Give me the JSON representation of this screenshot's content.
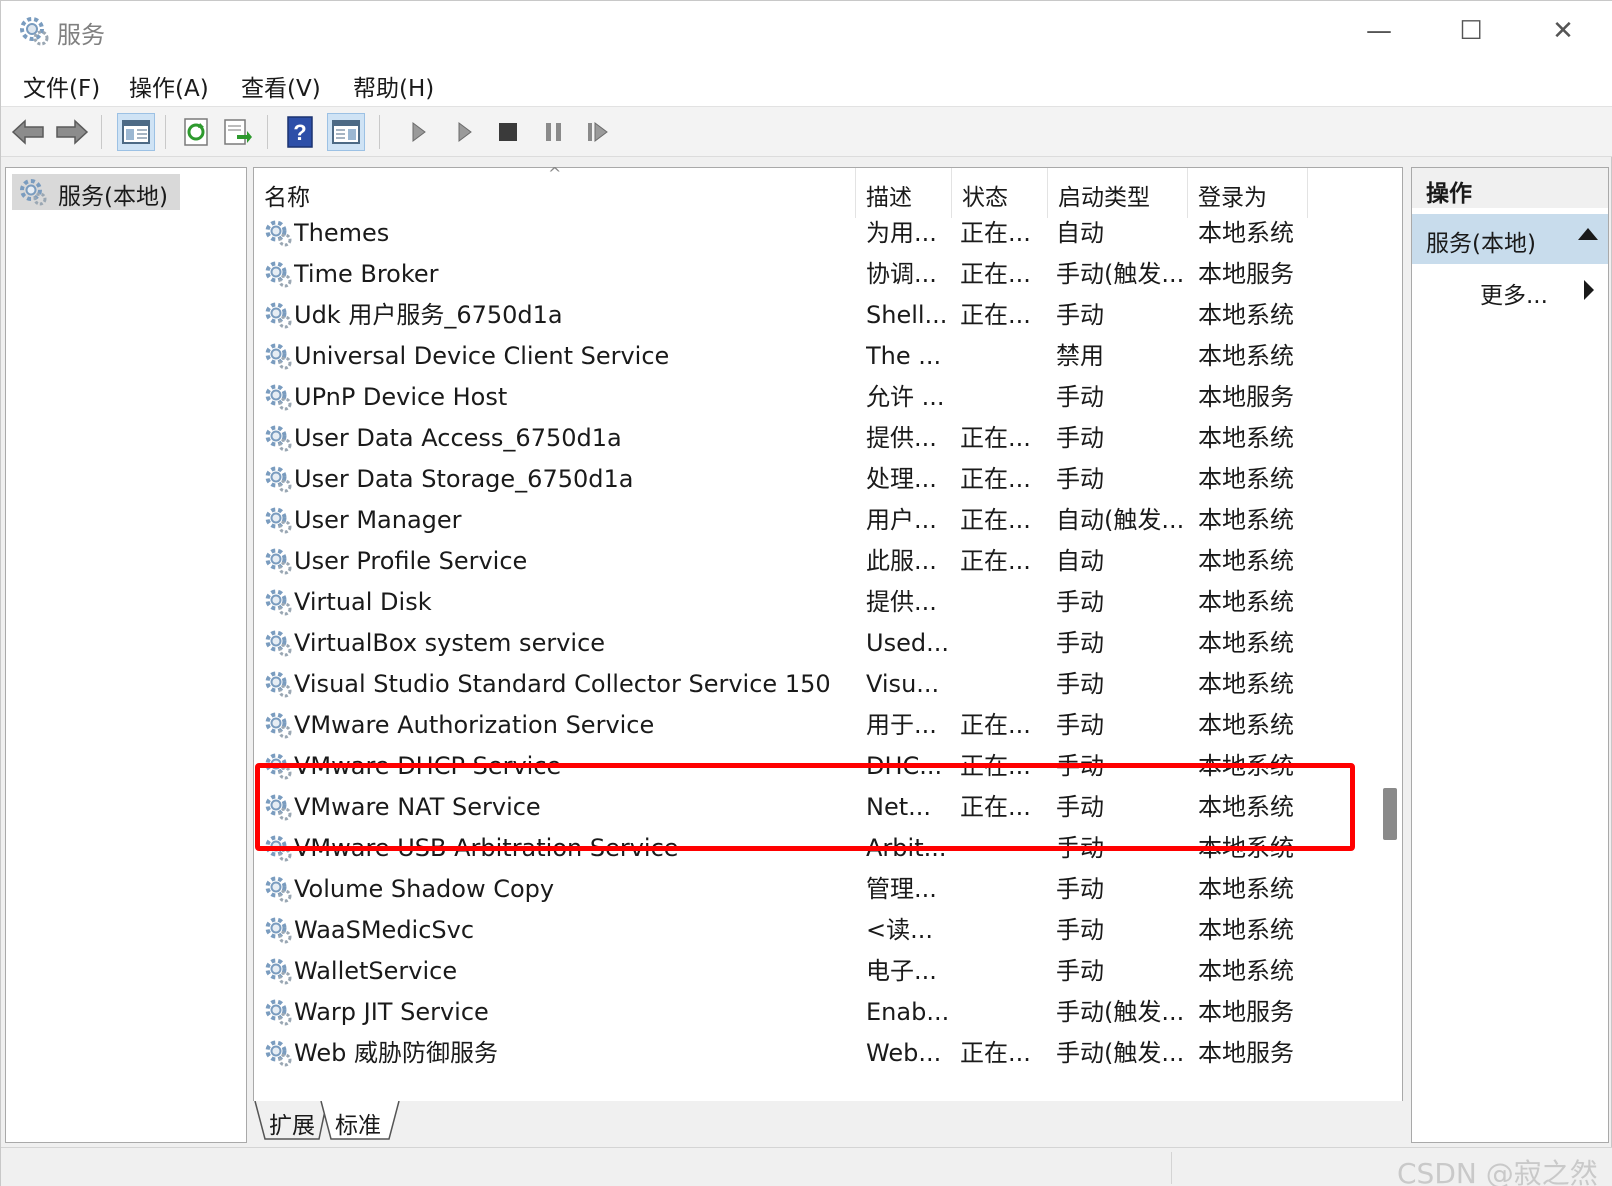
{
  "window": {
    "title": "服务",
    "minimize_glyph": "—",
    "maximize_glyph": "☐",
    "close_glyph": "✕"
  },
  "menu": [
    "文件(F)",
    "操作(A)",
    "查看(V)",
    "帮助(H)"
  ],
  "toolbar": {
    "buttons": [
      "back-icon",
      "forward-icon",
      "show-hide-console-tree-icon",
      "refresh-icon",
      "export-list-icon",
      "help-icon",
      "show-hide-action-pane-icon",
      "start-service-icon",
      "start-service-alt-icon",
      "stop-service-icon",
      "pause-service-icon",
      "restart-service-icon"
    ],
    "help_glyph": "?"
  },
  "tree": {
    "root_label": "服务(本地)"
  },
  "table": {
    "columns": [
      "名称",
      "描述",
      "状态",
      "启动类型",
      "登录为"
    ],
    "sort_glyph": "^",
    "rows": [
      {
        "name": "Themes",
        "desc": "为用...",
        "status": "正在...",
        "startup": "自动",
        "logon": "本地系统"
      },
      {
        "name": "Time Broker",
        "desc": "协调...",
        "status": "正在...",
        "startup": "手动(触发...",
        "logon": "本地服务"
      },
      {
        "name": "Udk 用户服务_6750d1a",
        "desc": "Shell...",
        "status": "正在...",
        "startup": "手动",
        "logon": "本地系统"
      },
      {
        "name": "Universal Device Client Service",
        "desc": "The ...",
        "status": "",
        "startup": "禁用",
        "logon": "本地系统"
      },
      {
        "name": "UPnP Device Host",
        "desc": "允许 ...",
        "status": "",
        "startup": "手动",
        "logon": "本地服务"
      },
      {
        "name": "User Data Access_6750d1a",
        "desc": "提供...",
        "status": "正在...",
        "startup": "手动",
        "logon": "本地系统"
      },
      {
        "name": "User Data Storage_6750d1a",
        "desc": "处理...",
        "status": "正在...",
        "startup": "手动",
        "logon": "本地系统"
      },
      {
        "name": "User Manager",
        "desc": "用户...",
        "status": "正在...",
        "startup": "自动(触发...",
        "logon": "本地系统"
      },
      {
        "name": "User Profile Service",
        "desc": "此服...",
        "status": "正在...",
        "startup": "自动",
        "logon": "本地系统"
      },
      {
        "name": "Virtual Disk",
        "desc": "提供...",
        "status": "",
        "startup": "手动",
        "logon": "本地系统"
      },
      {
        "name": "VirtualBox system service",
        "desc": "Used...",
        "status": "",
        "startup": "手动",
        "logon": "本地系统"
      },
      {
        "name": "Visual Studio Standard Collector Service 150",
        "desc": "Visu...",
        "status": "",
        "startup": "手动",
        "logon": "本地系统"
      },
      {
        "name": "VMware Authorization Service",
        "desc": "用于...",
        "status": "正在...",
        "startup": "手动",
        "logon": "本地系统"
      },
      {
        "name": "VMware DHCP Service",
        "desc": "DHC...",
        "status": "正在...",
        "startup": "手动",
        "logon": "本地系统"
      },
      {
        "name": "VMware NAT Service",
        "desc": "Net...",
        "status": "正在...",
        "startup": "手动",
        "logon": "本地系统"
      },
      {
        "name": "VMware USB Arbitration Service",
        "desc": "Arbit...",
        "status": "",
        "startup": "手动",
        "logon": "本地系统"
      },
      {
        "name": "Volume Shadow Copy",
        "desc": "管理...",
        "status": "",
        "startup": "手动",
        "logon": "本地系统"
      },
      {
        "name": "WaaSMedicSvc",
        "desc": "<读...",
        "status": "",
        "startup": "手动",
        "logon": "本地系统"
      },
      {
        "name": "WalletService",
        "desc": "电子...",
        "status": "",
        "startup": "手动",
        "logon": "本地系统"
      },
      {
        "name": "Warp JIT Service",
        "desc": "Enab...",
        "status": "",
        "startup": "手动(触发...",
        "logon": "本地服务"
      },
      {
        "name": "Web 威胁防御服务",
        "desc": "Web...",
        "status": "正在...",
        "startup": "手动(触发...",
        "logon": "本地服务"
      }
    ]
  },
  "tabs": [
    "扩展",
    "标准"
  ],
  "actions": {
    "header": "操作",
    "group_label": "服务(本地)",
    "more_label": "更多..."
  },
  "watermark": "CSDN @寂之然",
  "colors": {
    "highlight_border": "#ff0000",
    "selected_group": "#c8dcec",
    "toolbar_active": "#cfe3f5"
  }
}
